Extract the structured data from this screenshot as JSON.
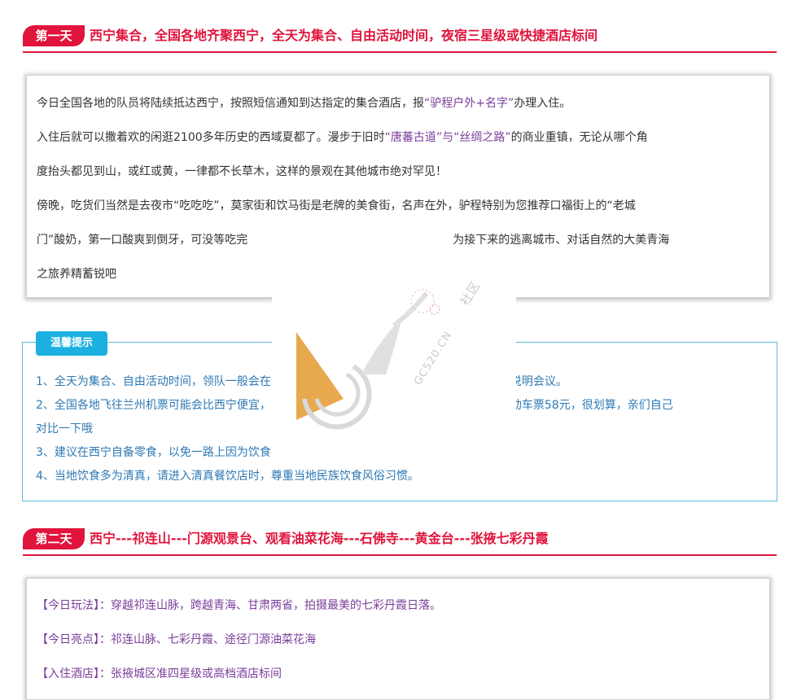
{
  "day1": {
    "badge": "第一天",
    "title": "西宁集合，全国各地齐聚西宁，全天为集合、自由活动时间，夜宿三星级或快捷酒店标间",
    "paragraphs": [
      [
        "今日全国各地的队员将陆续抵达西宁，按照短信通知到达指定的集合酒店，报",
        "“驴程户外+名字”",
        "办理入住。"
      ],
      [
        "入住后就可以撒着欢的闲逛2100多年历史的西域夏都了。漫步于旧时",
        "“唐蕃古道”与“丝绸之路”",
        "的商业重镇，无论从哪个角"
      ],
      [
        "度抬头都见到山，或红或黄，一律都不长草木，这样的景观在其他城市绝对罕见！",
        "",
        ""
      ],
      [
        "傍晚，吃货们当然是去夜市“吃吃吃”，莫家街和饮马街是老牌的美食街，名声在外，驴程特别为您推荐口福街上的“老城",
        "",
        ""
      ],
      [
        "门”酸奶，第一口酸爽到倒牙，可没等吃完",
        "",
        "为接下来的逃离城市、对话自然的大美青海"
      ],
      [
        "之旅养精蓄锐吧",
        "",
        ""
      ]
    ]
  },
  "tips": {
    "badge": "温馨提示",
    "items": [
      "1、全天为集合、自由活动时间，领队一般会在晚上联系您，请保持手机畅通，并准时参加行前说明会议。",
      "2、全国各地飞往兰州机票可能会比西宁便宜，到达兰州后可以在兰州西站乘坐动车前往西宁，动车票58元，很划算，亲们自己",
      "对比一下哦",
      "3、建议在西宁自备零食，以免一路上因为饮食不习惯而饿肚子。",
      "4、当地饮食多为清真，请进入清真餐饮店时，尊重当地民族饮食风俗习惯。"
    ]
  },
  "day2": {
    "badge": "第二天",
    "title": "西宁---祁连山---门源观景台、观看油菜花海---石佛寺---黄金台---张掖七彩丹霞",
    "rows": [
      {
        "tag": "【今日玩法】",
        "text": "：穿越祁连山脉，跨越青海、甘肃两省，拍摄最美的七彩丹霞日落。"
      },
      {
        "tag": "【今日亮点】",
        "text": "：祁连山脉、七彩丹霞、途径门源油菜花海"
      },
      {
        "tag": "【入住酒店】",
        "text": "：张掖城区准四星级或高档酒店标间"
      }
    ]
  },
  "watermark": {
    "brand": "GC520.CN",
    "cn": "社区",
    "colors": {
      "accent": "#e0143c",
      "tips": "#1bb0e0",
      "logo": "#e8a94e"
    }
  }
}
